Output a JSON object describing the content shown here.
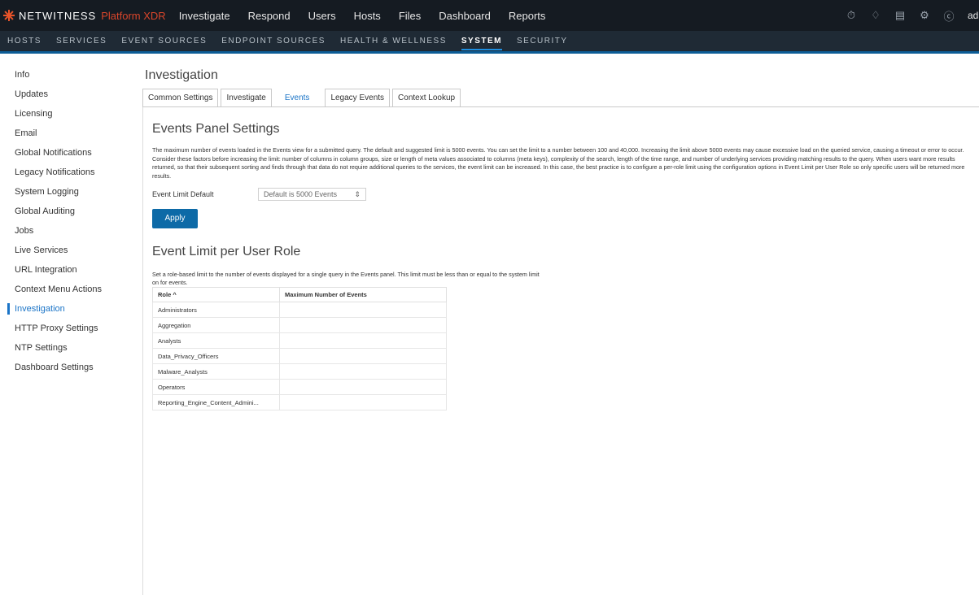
{
  "topbar": {
    "brand": "NETWITNESS",
    "platform": "Platform XDR",
    "nav": [
      "Investigate",
      "Respond",
      "Users",
      "Hosts",
      "Files",
      "Dashboard",
      "Reports"
    ],
    "icons": [
      "timer-icon",
      "bell-icon",
      "notes-icon",
      "tools-icon",
      "help-icon"
    ],
    "user": "admi"
  },
  "subnav": {
    "items": [
      "HOSTS",
      "SERVICES",
      "EVENT SOURCES",
      "ENDPOINT SOURCES",
      "HEALTH & WELLNESS",
      "SYSTEM",
      "SECURITY"
    ],
    "active": "SYSTEM"
  },
  "sidebar": {
    "items": [
      "Info",
      "Updates",
      "Licensing",
      "Email",
      "Global Notifications",
      "Legacy Notifications",
      "System Logging",
      "Global Auditing",
      "Jobs",
      "Live Services",
      "URL Integration",
      "Context Menu Actions",
      "Investigation",
      "HTTP Proxy Settings",
      "NTP Settings",
      "Dashboard Settings"
    ],
    "active": "Investigation"
  },
  "main": {
    "title": "Investigation",
    "tabs": [
      "Common Settings",
      "Investigate",
      "Events",
      "Legacy Events",
      "Context Lookup"
    ],
    "active_tab": "Events",
    "events_panel": {
      "title": "Events Panel Settings",
      "description": "The maximum number of events loaded in the Events view for a submitted query. The default and suggested limit is 5000 events. You can set the limit to a number between 100 and 40,000. Increasing the limit above 5000 events may cause excessive load on the queried service, causing a timeout or error to occur. Consider these factors before increasing the limit: number of columns in column groups, size or length of meta values associated to columns (meta keys), complexity of the search, length of the time range, and number of underlying services providing matching results to the query. When users want more results returned, so that their subsequent sorting and finds through that data do not require additional queries to the services, the event limit can be increased. In this case, the best practice is to configure a per-role limit using the configuration options in Event Limit per User Role so only specific users will be returned more results.",
      "limit_label": "Event Limit Default",
      "limit_value": "Default is 5000 Events",
      "apply_label": "Apply"
    },
    "role_limit": {
      "title": "Event Limit per User Role",
      "description": "Set a role-based limit to the number of events displayed for a single query in the Events panel. This limit must be less than or equal to the system limit on for events.",
      "columns": [
        "Role ^",
        "Maximum Number of Events"
      ],
      "rows": [
        "Administrators",
        "Aggregation",
        "Analysts",
        "Data_Privacy_Officers",
        "Malware_Analysts",
        "Operators",
        "Reporting_Engine_Content_Admini..."
      ]
    }
  },
  "colors": {
    "topbar": "#151b22",
    "subnav": "#1f2a35",
    "accent": "#1a74c7",
    "brand_red": "#d9462b",
    "button": "#0d6aa7"
  }
}
